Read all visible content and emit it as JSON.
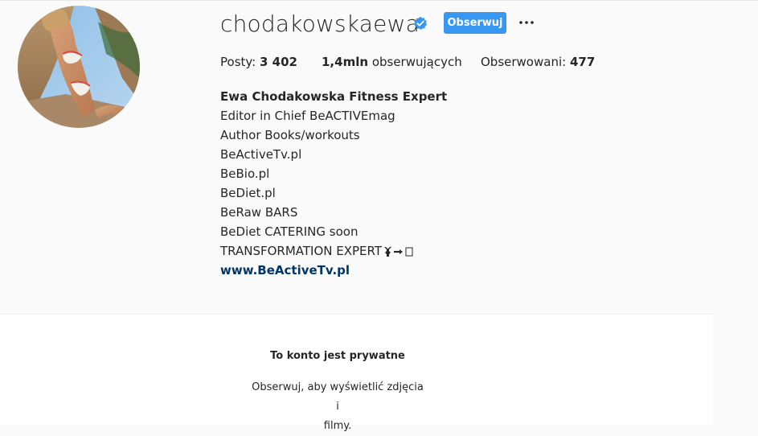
{
  "profile": {
    "username": "chodakowskaewa",
    "verified_icon": "verified-badge-icon",
    "follow_label": "Obserwuj",
    "more_icon": "more-options-icon",
    "avatar_alt": "profile-photo"
  },
  "stats": {
    "posts_label": "Posty:",
    "posts_value": "3 402",
    "followers_value": "1,4mln",
    "followers_label": "obserwujących",
    "following_label": "Obserwowani:",
    "following_value": "477"
  },
  "bio": {
    "full_name": "Ewa Chodakowska Fitness Expert",
    "lines": [
      "Editor in Chief BeACTIVEmag",
      "Author Books/workouts",
      "BeActiveTv.pl",
      "BeBio.pl",
      "BeDiet.pl",
      "BeRaw BARS",
      "BeDiet CATERING soon",
      "TRANSFORMATION EXPERT"
    ],
    "link": "www.BeActiveTv.pl"
  },
  "private": {
    "title": "To konto jest prywatne",
    "subtitle_line1": "Obserwuj, aby wyświetlić zdjęcia i",
    "subtitle_line2": "filmy."
  },
  "colors": {
    "accent": "#3897f0",
    "link": "#003569",
    "background": "#fafafa"
  }
}
